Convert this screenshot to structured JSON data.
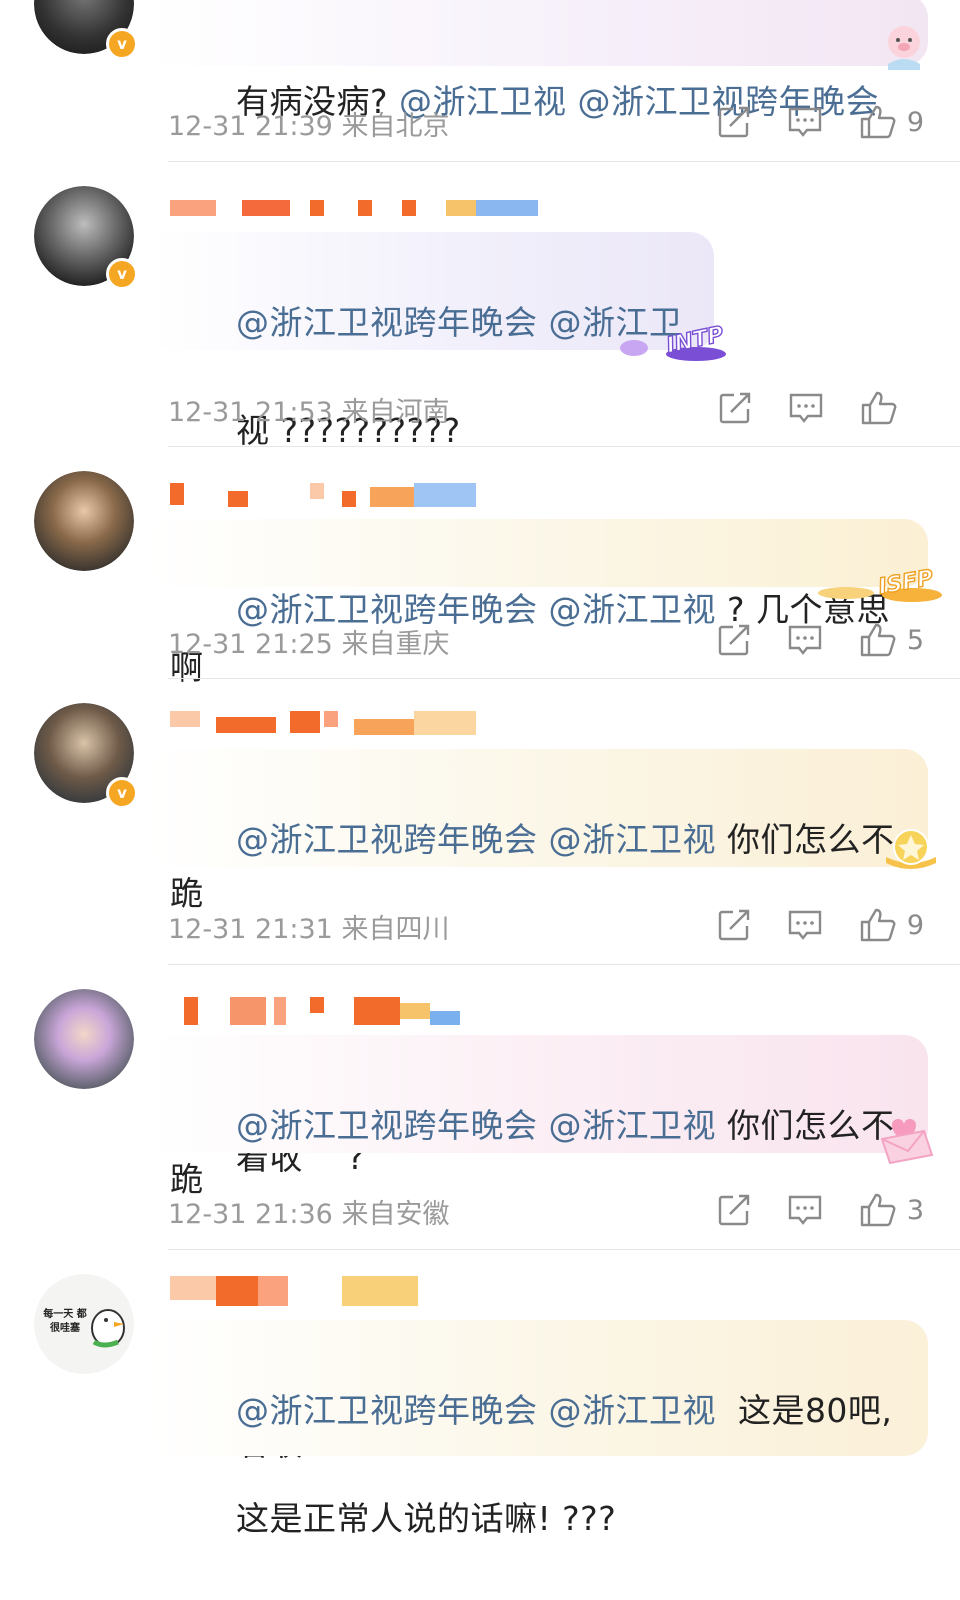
{
  "comments": [
    {
      "text_plain": "有病没病? ",
      "mentions": [
        "@浙江卫视",
        "@浙江卫视跨年晚会"
      ],
      "time": "12-31 21:39",
      "location": "来自北京",
      "likes": "9"
    },
    {
      "mentions": [
        "@浙江卫视跨年晚会",
        "@浙江卫"
      ],
      "line2": "视 ??????????",
      "badge": "INTP",
      "time": "12-31 21:53",
      "location": "来自河南",
      "likes": ""
    },
    {
      "mentions": [
        "@浙江卫视跨年晚会",
        "@浙江卫视"
      ],
      "text_plain": "? 几个意思啊",
      "badge": "ISFP",
      "time": "12-31 21:25",
      "location": "来自重庆",
      "likes": "5"
    },
    {
      "mentions": [
        "@浙江卫视跨年晚会",
        "@浙江卫视"
      ],
      "text_plain": "你们怎么不跪",
      "line2_a": "着收",
      "line2_b": "?",
      "time": "12-31 21:31",
      "location": "来自四川",
      "likes": "9"
    },
    {
      "mentions": [
        "@浙江卫视跨年晚会",
        "@浙江卫视"
      ],
      "text_plain": "你们怎么不跪",
      "line2_a": "着收",
      "time": "12-31 21:36",
      "location": "来自安徽",
      "likes": "3"
    },
    {
      "mentions": [
        "@浙江卫视跨年晚会",
        "@浙江卫视"
      ],
      "text_plain": "这是80吧,",
      "line2": "这是正常人说的话嘛! ???",
      "avatar_text": "每一天 都很哇塞"
    }
  ],
  "colors": {
    "mention": "#4a6d94",
    "meta": "#9a9a9a",
    "verified": "#f5a623"
  },
  "icons": [
    "repost-icon",
    "comment-icon",
    "like-icon",
    "money-bag-icon",
    "verified-icon"
  ]
}
